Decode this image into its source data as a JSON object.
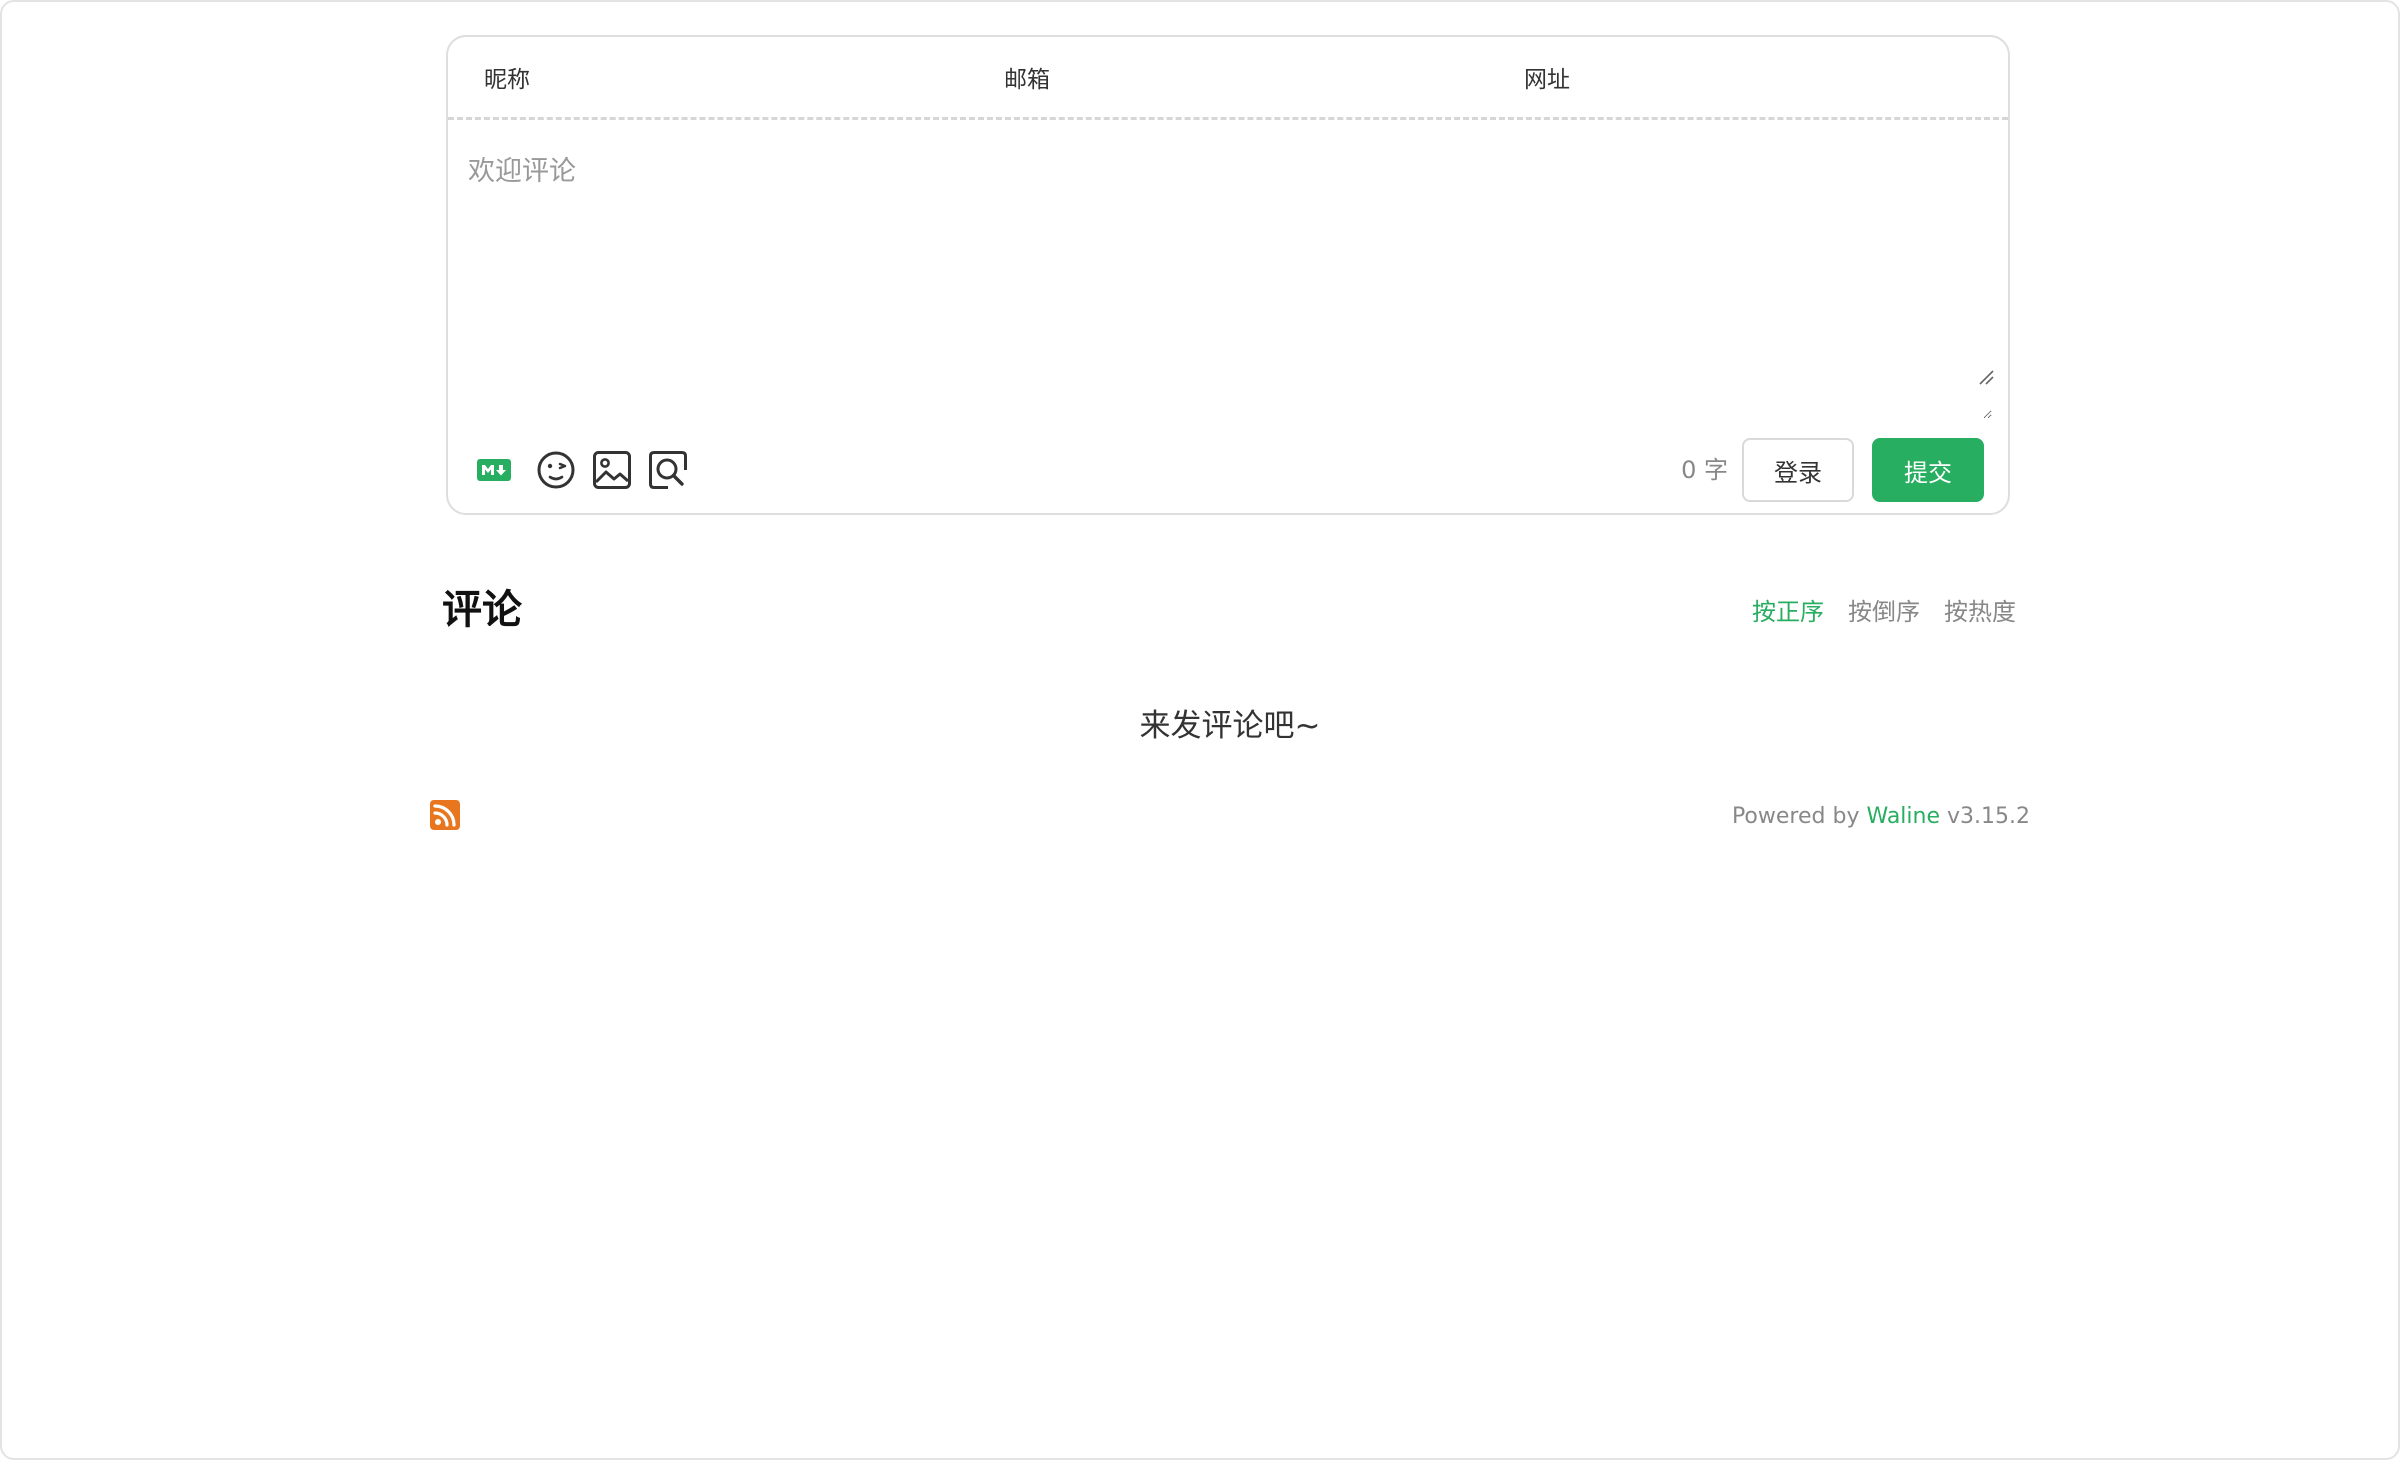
{
  "form": {
    "fields": [
      {
        "label": "昵称",
        "value": ""
      },
      {
        "label": "邮箱",
        "value": ""
      },
      {
        "label": "网址",
        "value": ""
      }
    ],
    "editor_placeholder": "欢迎评论",
    "toolbar": {
      "icons": [
        "markdown-icon",
        "emoji-icon",
        "image-upload-icon",
        "preview-icon"
      ]
    },
    "word_count": "0",
    "word_unit": "字",
    "login_label": "登录",
    "submit_label": "提交"
  },
  "comments": {
    "title": "评论",
    "sort_options": [
      {
        "label": "按正序",
        "active": true
      },
      {
        "label": "按倒序",
        "active": false
      },
      {
        "label": "按热度",
        "active": false
      }
    ],
    "empty_text": "来发评论吧~"
  },
  "footer": {
    "powered_prefix": "Powered by",
    "powered_link": "Waline",
    "version": "v3.15.2"
  },
  "colors": {
    "accent": "#27ae60",
    "rss": "#e8761f"
  }
}
